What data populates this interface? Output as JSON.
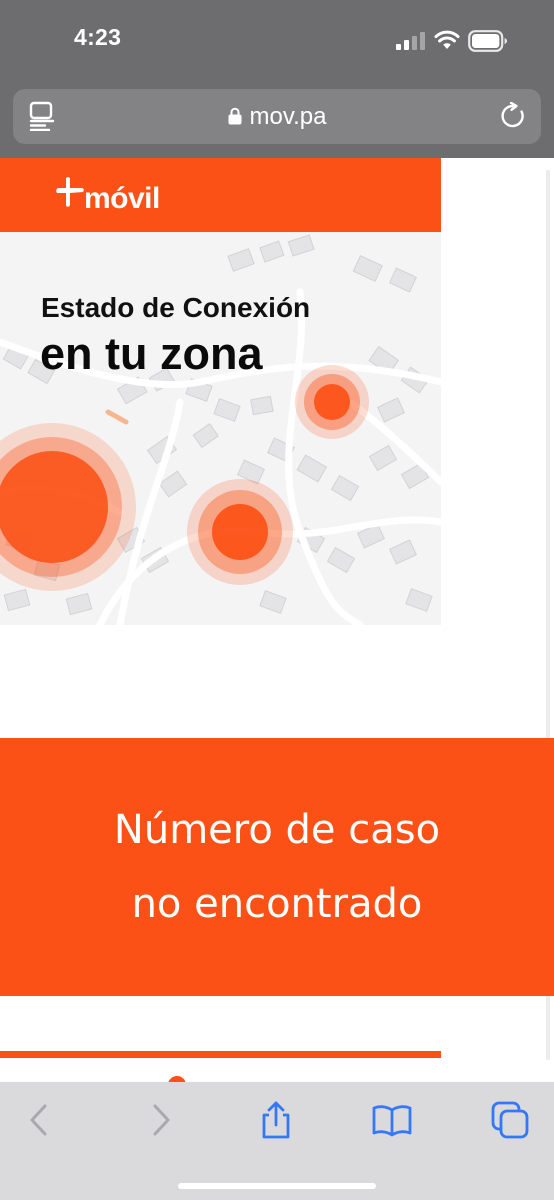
{
  "status_bar": {
    "time": "4:23",
    "icons": [
      "cellular-signal-icon",
      "wifi-icon",
      "battery-icon"
    ]
  },
  "browser": {
    "url": "mov.pa",
    "icons": [
      "reader-mode-icon",
      "lock-icon",
      "reload-icon"
    ]
  },
  "page": {
    "brand": {
      "name": "móvil",
      "accent_color": "#fc5116"
    },
    "hero": {
      "title_line_1": "Estado de Conexión",
      "title_line_2": "en tu zona"
    },
    "result": {
      "line_1": "Número de caso",
      "line_2": "no encontrado"
    }
  },
  "toolbar": {
    "buttons": [
      {
        "name": "back-button",
        "icon": "chevron-left-icon",
        "enabled": false
      },
      {
        "name": "forward-button",
        "icon": "chevron-right-icon",
        "enabled": false
      },
      {
        "name": "share-button",
        "icon": "share-icon",
        "enabled": true
      },
      {
        "name": "bookmarks-button",
        "icon": "book-icon",
        "enabled": true
      },
      {
        "name": "tabs-button",
        "icon": "tabs-icon",
        "enabled": true
      }
    ],
    "active_color": "#3478f6",
    "disabled_color": "#a9a9ad"
  }
}
